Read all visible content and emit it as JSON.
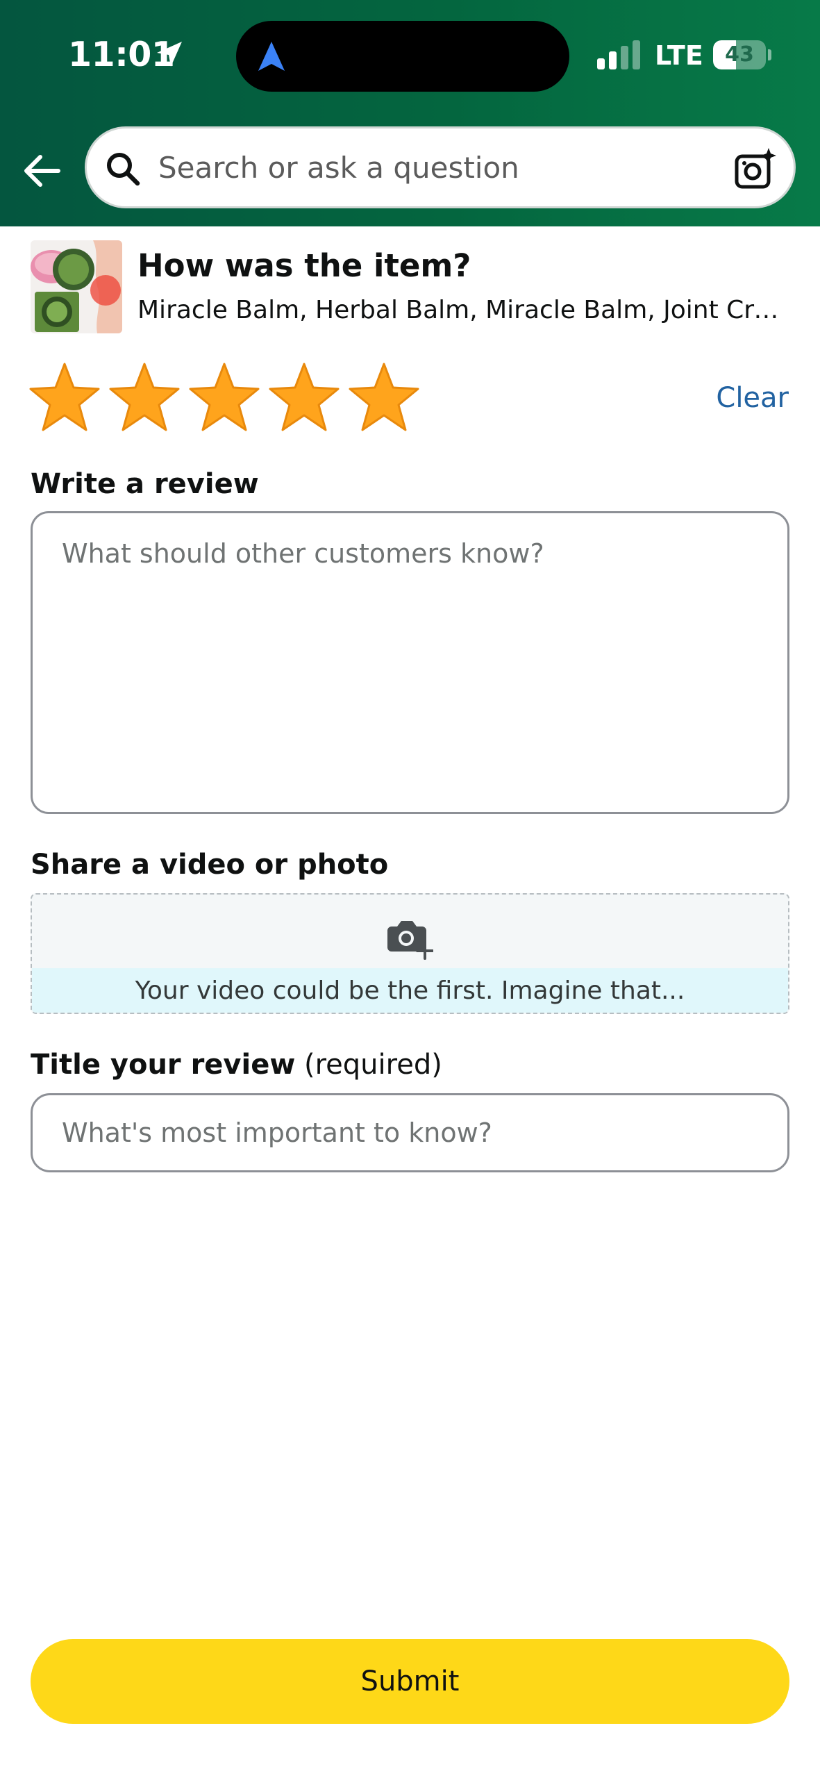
{
  "status_bar": {
    "time": "11:01",
    "network": "LTE",
    "battery_percent": "43",
    "battery_level": 0.43
  },
  "search": {
    "placeholder": "Search or ask a question"
  },
  "product": {
    "question": "How was the item?",
    "name": "Miracle Balm, Herbal Balm, Miracle Balm, Joint Crea…"
  },
  "rating": {
    "stars_selected": 5,
    "stars_total": 5,
    "clear_label": "Clear"
  },
  "review": {
    "label": "Write a review",
    "placeholder": "What should other customers know?"
  },
  "media": {
    "label": "Share a video or photo",
    "hint": "Your video could be the first. Imagine that..."
  },
  "title_field": {
    "label": "Title your review",
    "label_suffix": " (required)",
    "placeholder": "What's most important to know?"
  },
  "submit": {
    "label": "Submit"
  },
  "colors": {
    "header_green": "#04663f",
    "star_orange": "#ffa41c",
    "link_blue": "#2162a1",
    "submit_yellow": "#fed818"
  },
  "icons": {
    "back": "arrow-left-icon",
    "search": "search-icon",
    "camera_search": "camera-search-icon",
    "media": "camera-add-icon",
    "star": "star-icon"
  }
}
